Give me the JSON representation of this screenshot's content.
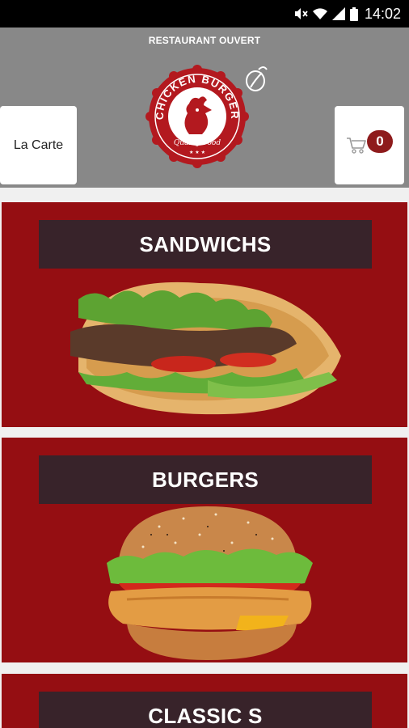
{
  "status_bar": {
    "time": "14:02"
  },
  "header": {
    "status": "RESTAURANT OUVERT",
    "logo": {
      "top_text": "CHICKEN BURGER",
      "tagline": "Quality Food",
      "stars": "★ ★ ★"
    },
    "menu_button": "La Carte",
    "cart_count": "0"
  },
  "colors": {
    "header_bg": "#888888",
    "card_bg": "#950e12",
    "title_bar_bg": "#38232a",
    "badge_bg": "#8e1b1c"
  },
  "categories": [
    {
      "title": "SANDWICHS",
      "icon": "sandwich-photo"
    },
    {
      "title": "BURGERS",
      "icon": "burger-photo"
    },
    {
      "title": "CLASSIC S",
      "icon": ""
    }
  ]
}
